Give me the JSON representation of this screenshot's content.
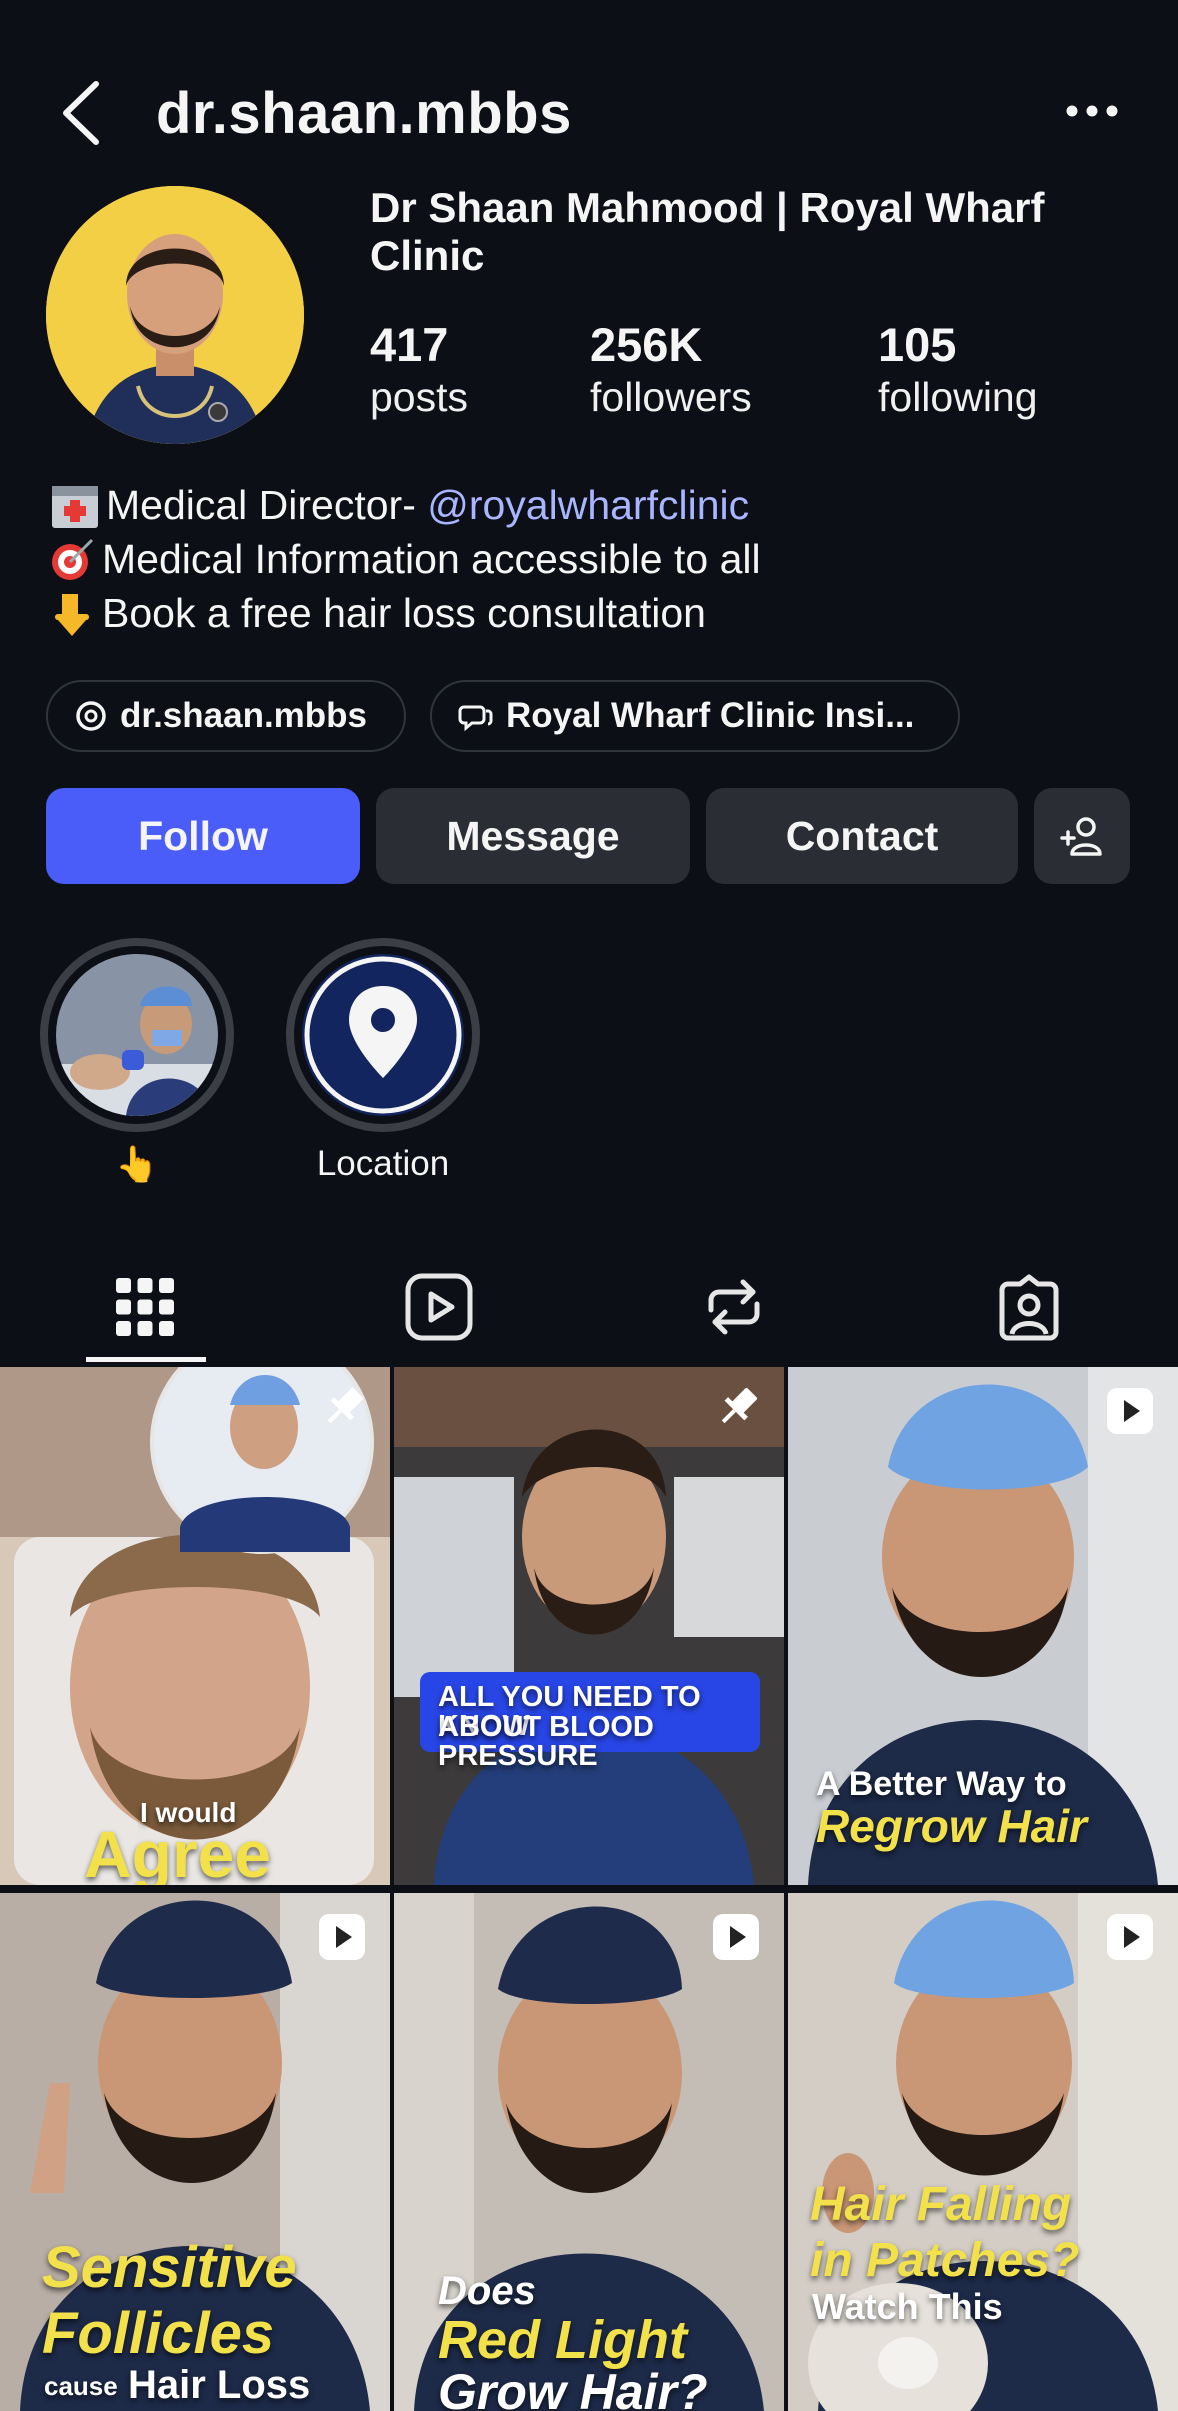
{
  "header": {
    "username": "dr.shaan.mbbs",
    "back_icon": "chevron-left-icon",
    "more_icon": "more-horizontal-icon"
  },
  "profile": {
    "display_name": "Dr Shaan Mahmood | Royal Wharf Clinic",
    "stats": [
      {
        "value": "417",
        "label": "posts"
      },
      {
        "value": "256K",
        "label": "followers"
      },
      {
        "value": "105",
        "label": "following"
      }
    ],
    "bio": {
      "line1_prefix": "Medical Director- ",
      "line1_mention": "@royalwharfclinic",
      "line2": "Medical Information accessible to all",
      "line3": "Book a free hair loss consultation"
    }
  },
  "chips": [
    {
      "icon": "threads-icon",
      "label": "dr.shaan.mbbs"
    },
    {
      "icon": "community-chat-icon",
      "label": "Royal Wharf Clinic Insi..."
    }
  ],
  "actions": {
    "follow": "Follow",
    "message": "Message",
    "contact": "Contact",
    "suggest_icon": "add-person-icon"
  },
  "highlights": [
    {
      "label": "👆"
    },
    {
      "label": "Location"
    }
  ],
  "tabs": [
    {
      "icon": "grid-icon",
      "active": true
    },
    {
      "icon": "reels-icon",
      "active": false
    },
    {
      "icon": "reposts-icon",
      "active": false
    },
    {
      "icon": "tagged-icon",
      "active": false
    }
  ],
  "posts": [
    {
      "badge": "pin-icon",
      "caption_small": "I would",
      "caption_big": "Agree"
    },
    {
      "badge": "pin-icon",
      "caption_line1": "ALL YOU NEED TO KNOW",
      "caption_line2": "ABOUT BLOOD PRESSURE"
    },
    {
      "badge": "reel-icon",
      "caption_white": "A Better Way to",
      "caption_yellow": "Regrow Hair"
    },
    {
      "badge": "reel-icon",
      "caption_line1": "Sensitive",
      "caption_line2": "Follicles",
      "caption_small": "cause",
      "caption_white": "Hair Loss"
    },
    {
      "badge": "reel-icon",
      "caption_white1": "Does",
      "caption_yellow": "Red Light",
      "caption_white2": "Grow Hair?"
    },
    {
      "badge": "reel-icon",
      "caption_line1": "Hair Falling",
      "caption_line2": "in Patches?",
      "caption_white": "Watch This"
    }
  ],
  "colors": {
    "background": "#0c0f16",
    "follow_button": "#4a5df9",
    "secondary_button": "#2a2d34",
    "mention": "#a9b5ff",
    "caption_yellow": "#f2e14a"
  }
}
